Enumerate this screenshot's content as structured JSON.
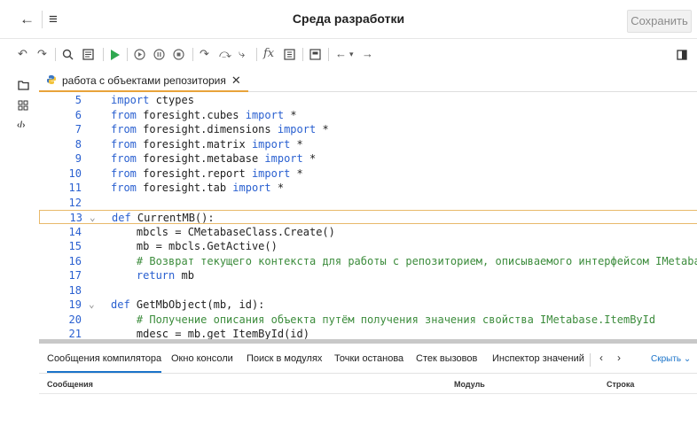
{
  "header": {
    "back_icon": "arrow-left-icon",
    "menu_icon": "hamburger-menu-icon",
    "title": "Среда разработки",
    "save_label": "Сохранить"
  },
  "toolbar": {
    "icons": [
      "undo-icon",
      "redo-icon",
      "search-icon",
      "debug-panel-icon",
      "run-icon",
      "step-start-icon",
      "pause-icon",
      "stop-icon",
      "step-over-icon",
      "step-into-icon",
      "step-out-icon",
      "function-icon",
      "evaluate-icon",
      "breakpoints-icon",
      "back-icon",
      "dropdown-icon",
      "forward-icon",
      "toggle-panel-icon"
    ],
    "run_color": "#2fa84f"
  },
  "rail": {
    "icons": [
      "folder-icon",
      "grid-icon",
      "code-icon"
    ]
  },
  "editor_tab": {
    "label": "работа с объектами репозитория",
    "icon": "python-icon",
    "accent": "#e8a33a"
  },
  "editor": {
    "lines": [
      {
        "n": "5",
        "fold": "",
        "code": "import ctypes"
      },
      {
        "n": "6",
        "fold": "",
        "code": "from foresight.cubes import *"
      },
      {
        "n": "7",
        "fold": "",
        "code": "from foresight.dimensions import *"
      },
      {
        "n": "8",
        "fold": "",
        "code": "from foresight.matrix import *"
      },
      {
        "n": "9",
        "fold": "",
        "code": "from foresight.metabase import *"
      },
      {
        "n": "10",
        "fold": "",
        "code": "from foresight.report import *"
      },
      {
        "n": "11",
        "fold": "",
        "code": "from foresight.tab import *"
      },
      {
        "n": "12",
        "fold": "",
        "code": ""
      },
      {
        "n": "13",
        "fold": "⌄",
        "code": "def CurrentMB():"
      },
      {
        "n": "14",
        "fold": "",
        "code": "    mbcls = CMetabaseClass.Create()"
      },
      {
        "n": "15",
        "fold": "",
        "code": "    mb = mbcls.GetActive()"
      },
      {
        "n": "16",
        "fold": "",
        "code": "    # Возврат текущего контекста для работы с репозиторием, описываемого интерфейсом IMetabase"
      },
      {
        "n": "17",
        "fold": "",
        "code": "    return mb"
      },
      {
        "n": "18",
        "fold": "",
        "code": ""
      },
      {
        "n": "19",
        "fold": "⌄",
        "code": "def GetMbObject(mb, id):"
      },
      {
        "n": "20",
        "fold": "",
        "code": "    # Получение описания объекта путём получения значения свойства IMetabase.ItemById"
      },
      {
        "n": "21",
        "fold": "",
        "code": "    mdesc = mb.get_ItemById(id)"
      }
    ],
    "current_line": "13"
  },
  "panel": {
    "tabs": [
      "Сообщения компилятора",
      "Окно консоли",
      "Поиск в модулях",
      "Точки останова",
      "Стек вызовов",
      "Инспектор значений"
    ],
    "active_tab": "Сообщения компилятора",
    "prev": "‹",
    "next": "›",
    "hide_label": "Скрыть",
    "columns": [
      "Сообщения",
      "Модуль",
      "Строка"
    ],
    "accent": "#1a73c9"
  }
}
